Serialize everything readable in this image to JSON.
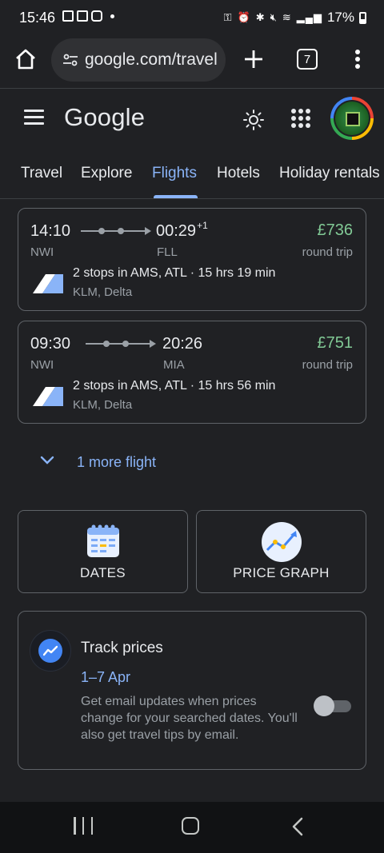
{
  "status_bar": {
    "time": "15:46",
    "battery": "17%"
  },
  "browser": {
    "url": "google.com/travel",
    "tab_count": "7"
  },
  "header": {
    "logo": "Google"
  },
  "tabs": [
    {
      "label": "Travel"
    },
    {
      "label": "Explore"
    },
    {
      "label": "Flights"
    },
    {
      "label": "Hotels"
    },
    {
      "label": "Holiday rentals"
    }
  ],
  "flights": [
    {
      "depart_time": "14:10",
      "arrive_time": "00:29",
      "day_offset": "+1",
      "from": "NWI",
      "to": "FLL",
      "price": "£736",
      "trip_type": "round trip",
      "stops": "2 stops in AMS, ATL · 15 hrs 19 min",
      "airlines": "KLM, Delta"
    },
    {
      "depart_time": "09:30",
      "arrive_time": "20:26",
      "day_offset": "",
      "from": "NWI",
      "to": "MIA",
      "price": "£751",
      "trip_type": "round trip",
      "stops": "2 stops in AMS, ATL · 15 hrs 56 min",
      "airlines": "KLM, Delta"
    }
  ],
  "more_flights": {
    "label": "1 more flight"
  },
  "features": {
    "dates_label": "DATES",
    "price_graph_label": "PRICE GRAPH"
  },
  "track_prices": {
    "title": "Track prices",
    "dates": "1–7 Apr",
    "description": "Get email updates when prices change for your searched dates. You'll also get travel tips by email.",
    "enabled": false
  },
  "colors": {
    "accent": "#8ab4f8",
    "price": "#81c995",
    "background": "#202124"
  }
}
